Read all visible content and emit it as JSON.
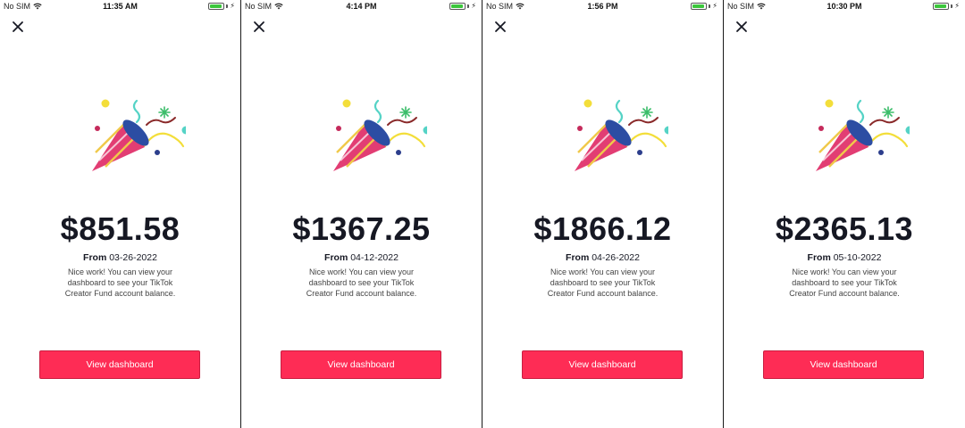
{
  "screens": [
    {
      "status": {
        "carrier": "No SIM",
        "time": "11:35 AM"
      },
      "amount": "$851.58",
      "from_label": "From",
      "from_date": "03-26-2022",
      "message": "Nice work! You can view your dashboard to see your TikTok Creator Fund account balance.",
      "cta_label": "View dashboard"
    },
    {
      "status": {
        "carrier": "No SIM",
        "time": "4:14 PM"
      },
      "amount": "$1367.25",
      "from_label": "From",
      "from_date": "04-12-2022",
      "message": "Nice work! You can view your dashboard to see your TikTok Creator Fund account balance.",
      "cta_label": "View dashboard"
    },
    {
      "status": {
        "carrier": "No SIM",
        "time": "1:56 PM"
      },
      "amount": "$1866.12",
      "from_label": "From",
      "from_date": "04-26-2022",
      "message": "Nice work! You can view your dashboard to see your TikTok Creator Fund account balance.",
      "cta_label": "View dashboard"
    },
    {
      "status": {
        "carrier": "No SIM",
        "time": "10:30 PM"
      },
      "amount": "$2365.13",
      "from_label": "From",
      "from_date": "05-10-2022",
      "message": "Nice work! You can view your dashboard to see your TikTok Creator Fund account balance.",
      "cta_label": "View dashboard"
    }
  ],
  "icons": {
    "close": "close-icon",
    "wifi": "wifi-icon",
    "battery": "battery-icon",
    "charging": "charging-icon",
    "celebration": "party-popper-icon"
  },
  "colors": {
    "accent": "#fe2c55",
    "text": "#161823",
    "battery_fill": "#3cc63c"
  }
}
